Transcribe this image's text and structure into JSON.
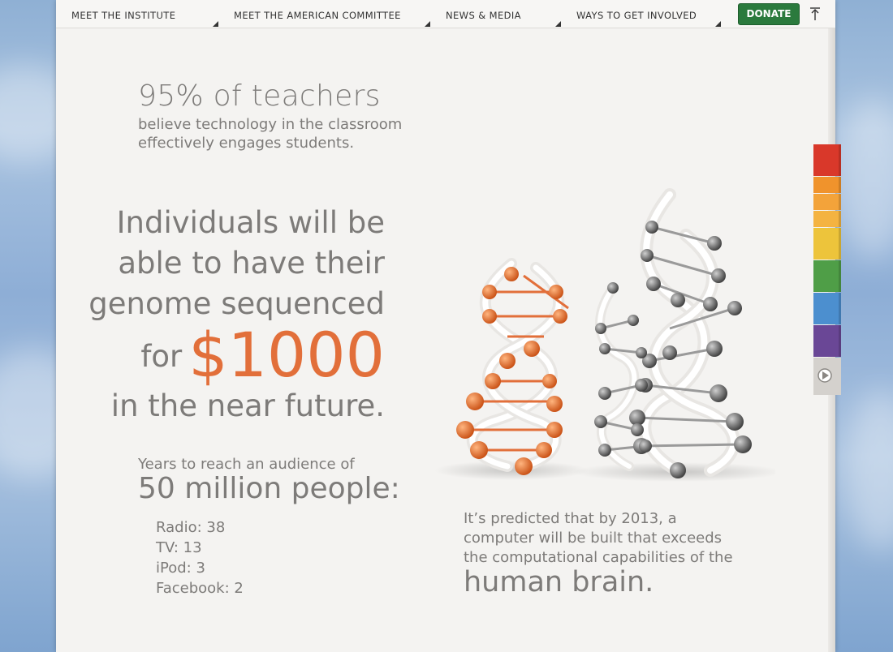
{
  "nav": {
    "items": [
      "Meet the Institute",
      "Meet the American Committee",
      "News & Media",
      "Ways to Get Involved"
    ],
    "donate_label": "DONATE"
  },
  "teachers": {
    "headline": "95% of teachers",
    "body": "believe technology in the classroom effectively engages students."
  },
  "genome": {
    "line1": "Individuals will be",
    "line2": "able to have their",
    "line3": "genome sequenced",
    "for_label": "for",
    "price": "$1000",
    "line5": "in the near future."
  },
  "audience": {
    "intro": "Years to reach an audience of",
    "headline": "50 million people:",
    "items": [
      "Radio: 38",
      "TV: 13",
      "iPod: 3",
      "Facebook: 2"
    ]
  },
  "prediction": {
    "body": "It’s predicted that by 2013, a computer will be built that exceeds the computational capabilities of the",
    "headline": "human brain."
  },
  "side_tabs": {
    "colors": [
      "#d9382a",
      "#f0932c",
      "#f3a33a",
      "#f4b341",
      "#edc43b",
      "#4f9e47",
      "#4c8fcf",
      "#6a4796"
    ],
    "play_icon": "play-icon"
  },
  "colors": {
    "accent": "#e26f3a",
    "text": "#7d7b79",
    "donate": "#2b7a3d"
  }
}
